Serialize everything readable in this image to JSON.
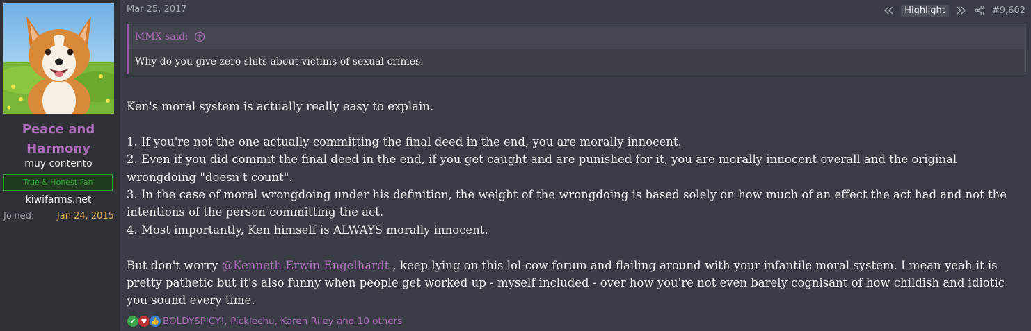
{
  "user": {
    "name_line1": "Peace and",
    "name_line2": "Harmony",
    "title": "muy contento",
    "banner": "True & Honest Fan",
    "site": "kiwifarms.net",
    "joined_label": "Joined:",
    "joined_value": "Jan 24, 2015"
  },
  "post": {
    "date": "Mar 25, 2017",
    "toolbar": {
      "highlight_label": "Highlight",
      "post_number": "#9,602"
    },
    "quote": {
      "author": "MMX said:",
      "text": "Why do you give zero shits about victims of sexual crimes."
    },
    "body": {
      "intro": "Ken's moral system is actually really easy to explain.",
      "points": [
        "1. If you're not the one actually committing the final deed in the end, you are morally innocent.",
        "2. Even if you did commit the final deed in the end, if you get caught and are punished for it, you are morally innocent overall and the original wrongdoing \"doesn't count\".",
        "3. In the case of moral wrongdoing under his definition, the weight of the wrongdoing is based solely on how much of an effect the act had and not the intentions of the person committing the act.",
        "4. Most importantly, Ken himself is ALWAYS morally innocent."
      ],
      "closing_before": "But don't worry ",
      "mention": "@Kenneth Erwin Engelhardt",
      "closing_after": " , keep lying on this lol-cow forum and flailing around with your infantile moral system. I mean yeah it is pretty pathetic but it's also funny when people get worked up - myself included - over how you're not even barely cognisant of how childish and idiotic you sound every time."
    },
    "reactions": {
      "text": "BOLDYSPICY!, Picklechu, Karen Riley and 10 others",
      "icons": [
        "check-icon",
        "heart-icon",
        "thumbs-up-icon"
      ]
    }
  },
  "colors": {
    "accent": "#b06bbd",
    "background": "#3a3d45",
    "sidebar": "#2f3137",
    "joined_date": "#e0a85a",
    "banner_green": "#2fa62f"
  }
}
